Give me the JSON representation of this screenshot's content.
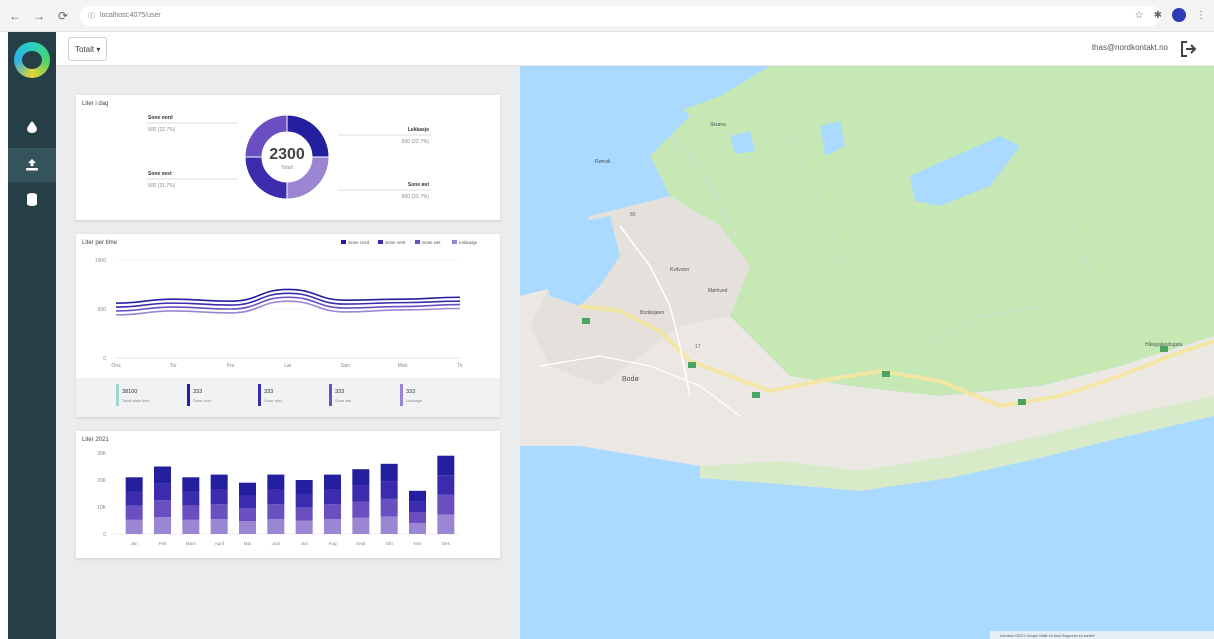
{
  "browser": {
    "url": "localhost:4075/user",
    "nav": {
      "back": "←",
      "forward": "→",
      "reload": "⟳"
    }
  },
  "header": {
    "total_button": "Totalt ▾",
    "user_email": "thas@nordkontakt.no"
  },
  "sidebar": {
    "items": [
      {
        "icon": "water-drop-icon",
        "glyph": "●"
      },
      {
        "icon": "upload-icon",
        "glyph": "⬆"
      },
      {
        "icon": "database-icon",
        "glyph": "▮"
      }
    ]
  },
  "donut_card": {
    "title": "Liter i dag",
    "center_value": "2300",
    "center_label": "Totalt",
    "segments": [
      {
        "label": "Sone nord",
        "sub": "500 (22.7%)",
        "color": "#231f9e",
        "value": 500
      },
      {
        "label": "Lekkasje",
        "sub": "500 (22.7%)",
        "color": "#9a86d2",
        "value": 500
      },
      {
        "label": "Sone vest",
        "sub": "500 (21.7%)",
        "color": "#6a4fc0",
        "value": 500
      },
      {
        "label": "Sone øst",
        "sub": "500 (22.7%)",
        "color": "#3b2cae",
        "value": 500
      }
    ]
  },
  "line_card": {
    "title": "Liter per time",
    "legend": [
      "Sone nord",
      "Sone vest",
      "Sone øst",
      "Lekkasje"
    ],
    "legend_colors": [
      "#231f9e",
      "#3b2cae",
      "#6a4fc0",
      "#9a86d2"
    ],
    "y_ticks": [
      "1000",
      "500",
      "0"
    ],
    "x_ticks": [
      "Ons",
      "Tor",
      "Fre",
      "Lør",
      "Søn",
      "Man",
      "Tir"
    ],
    "chart_data": {
      "type": "line",
      "categories": [
        "Ons",
        "Tor",
        "Fre",
        "Lør",
        "Søn",
        "Man",
        "Tir"
      ],
      "ylim": [
        0,
        1000
      ],
      "series": [
        {
          "name": "Sone nord",
          "color": "#231f9e",
          "values": [
            560,
            600,
            580,
            700,
            590,
            600,
            620
          ]
        },
        {
          "name": "Sone vest",
          "color": "#3b2cae",
          "values": [
            520,
            560,
            540,
            660,
            550,
            565,
            580
          ]
        },
        {
          "name": "Sone øst",
          "color": "#6a4fc0",
          "values": [
            480,
            520,
            500,
            620,
            510,
            525,
            545
          ]
        },
        {
          "name": "Lekkasje",
          "color": "#9a86d2",
          "values": [
            440,
            480,
            460,
            580,
            470,
            490,
            505
          ]
        }
      ]
    },
    "stats": [
      {
        "value": "38100",
        "label": "Totalt siste time",
        "color": "#9fd6c9"
      },
      {
        "value": "333",
        "label": "Sone nord",
        "color": "#231f9e"
      },
      {
        "value": "333",
        "label": "Sone vest",
        "color": "#3b2cae"
      },
      {
        "value": "333",
        "label": "Sone øst",
        "color": "#6a4fc0"
      },
      {
        "value": "333",
        "label": "Lekkasje",
        "color": "#9a86d2"
      }
    ]
  },
  "bar_card": {
    "title": "Liter 2021",
    "y_ticks": [
      "30K",
      "20K",
      "10K",
      "0"
    ],
    "chart_data": {
      "type": "bar",
      "categories": [
        "Jan",
        "Feb",
        "Mars",
        "April",
        "Mai",
        "Juni",
        "Juli",
        "Aug",
        "Sept",
        "Okt",
        "Nov",
        "Des"
      ],
      "ylim": [
        0,
        30000
      ],
      "series_colors": [
        "#9a86d2",
        "#6a4fc0",
        "#3b2cae",
        "#231f9e"
      ],
      "totals": [
        21000,
        25000,
        21000,
        22000,
        19000,
        22000,
        20000,
        22000,
        24000,
        26000,
        16000,
        29000
      ]
    }
  },
  "map": {
    "labels": [
      {
        "text": "Skrøva",
        "kind": "town"
      },
      {
        "text": "Rønvik",
        "kind": "town"
      },
      {
        "text": "Kvitvann",
        "kind": "area"
      },
      {
        "text": "Bodø",
        "kind": "city"
      },
      {
        "text": "Mørkved",
        "kind": "town"
      },
      {
        "text": "Bodøsjøen",
        "kind": "area"
      },
      {
        "text": "Hålogalandsgata",
        "kind": "road"
      },
      {
        "text": "80",
        "kind": "road-shield"
      },
      {
        "text": "17",
        "kind": "road-shield"
      }
    ],
    "attribution": "Kartdata ©2021 Google  Vilkår for bruk  Rapporter en kartfeil"
  }
}
